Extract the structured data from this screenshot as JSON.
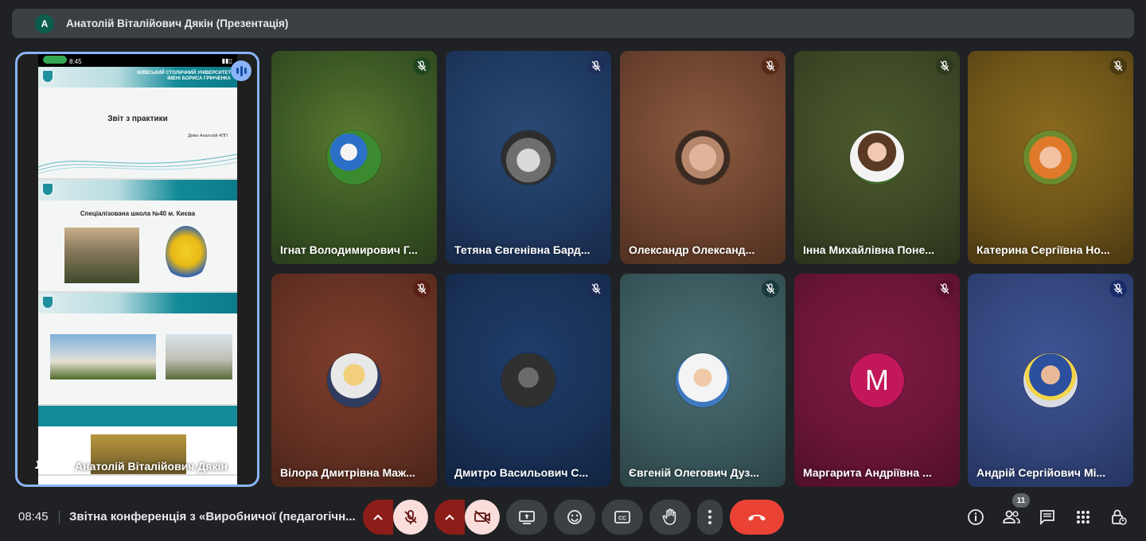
{
  "header": {
    "avatar_letter": "A",
    "title": "Анатолій Віталійович Дякін (Презентація)"
  },
  "presentation": {
    "owner_name": "Анатолій Віталійович Дякін",
    "phone_time": "8:45",
    "slides": [
      {
        "band_text": "КИЇВСЬКИЙ СТОЛИЧНИЙ УНІВЕРСИТЕТ ІМЕНІ БОРИСА ГРІНЧЕНКА",
        "title": "Звіт з практики",
        "author": "Дякін Анатолій 4ПП"
      },
      {
        "title": "Спеціалізована школа №40 м. Києва"
      },
      {
        "title": ""
      },
      {
        "title": ""
      }
    ]
  },
  "participants": [
    {
      "name": "Ігнат Володимирович Г...",
      "mic_color": "#1e4620",
      "bg": "radial-gradient(circle at 50% 40%, #5a7a30 0%, #3d5a25 50%, #2a3d1c 100%)",
      "avatar_type": "photo",
      "avatar_bg": "radial-gradient(circle at 40% 40%, #f4f4f4 0 18%, #2b6fc7 19% 40%, #3b8a2f 41% 100%)"
    },
    {
      "name": "Тетяна Євгенівна Бард...",
      "mic_color": "#1d2f5a",
      "bg": "radial-gradient(circle at 50% 40%, #2a4a74 0%, #1f3a60 55%, #17294a 100%)",
      "avatar_type": "photo",
      "avatar_bg": "radial-gradient(circle at 50% 55%, #d9d9d9 0 28%, #6e6e6e 30% 55%, #2e2e2e 56% 100%)"
    },
    {
      "name": "Олександр Олександ...",
      "mic_color": "#5a2a18",
      "bg": "radial-gradient(circle at 50% 40%, #8a5a3e 0%, #6e4430 55%, #50301f 100%)",
      "avatar_type": "photo",
      "avatar_bg": "radial-gradient(circle at 50% 50%, #e0b39a 0 35%, #b7876c 36% 55%, #3a2a22 56% 100%)"
    },
    {
      "name": "Інна Михайлівна Поне...",
      "mic_color": "#2d3a1e",
      "bg": "radial-gradient(circle at 50% 40%, #4c5a2c 0%, #3d4926 55%, #2a331b 100%)",
      "avatar_type": "photo",
      "avatar_bg": "radial-gradient(circle at 50% 40%, #f1c9b0 0 22%, #5a3a24 23% 45%, #f3f3f3 46% 70%, #3f6b2c 71% 100%)"
    },
    {
      "name": "Катерина Сергіївна Но...",
      "mic_color": "#4a3a10",
      "bg": "radial-gradient(circle at 50% 40%, #8a6a1e 0%, #6e5418 55%, #4a3812 100%)",
      "avatar_type": "photo",
      "avatar_bg": "radial-gradient(circle at 50% 50%, #f2c2a2 0 28%, #e07a2a 29% 55%, #6b8b2e 56% 100%)"
    },
    {
      "name": "Вілора Дмитрівна Маж...",
      "mic_color": "#5a1f14",
      "bg": "radial-gradient(circle at 50% 40%, #7e3e2c 0%, #663224 55%, #4a2419 100%)",
      "avatar_type": "photo",
      "avatar_bg": "radial-gradient(circle at 50% 40%, #f2cf7a 0 25%, #e8e8e8 26% 55%, #2f3c60 56% 100%)"
    },
    {
      "name": "Дмитро Васильович С...",
      "mic_color": "#1b2b52",
      "bg": "radial-gradient(circle at 50% 40%, #1f3c6a 0%, #193257 55%, #112341 100%)",
      "avatar_type": "photo",
      "avatar_bg": "radial-gradient(circle at 50% 45%, #6b6b6b 0 25%, #303030 26% 100%)"
    },
    {
      "name": "Євгеній Олегович Дуз...",
      "mic_color": "#1c3a3e",
      "bg": "radial-gradient(circle at 50% 40%, #4a6e72 0%, #3b5a5e 55%, #2a4245 100%)",
      "avatar_type": "photo",
      "avatar_bg": "radial-gradient(circle at 50% 45%, #f0c9a8 0 22%, #f4f4f4 23% 60%, #3f7ac0 61% 100%)"
    },
    {
      "name": "Маргарита Андріївна ...",
      "mic_color": "#5a0f2c",
      "bg": "radial-gradient(circle at 50% 40%, #7e1a42 0%, #6b1538 55%, #4f0f29 100%)",
      "avatar_type": "letter",
      "letter": "M"
    },
    {
      "name": "Андрій Сергійович Мі...",
      "mic_color": "#1a2c6a",
      "bg": "radial-gradient(circle at 50% 40%, #3e5494 0%, #33467c 55%, #243360 100%)",
      "avatar_type": "photo",
      "avatar_bg": "radial-gradient(circle at 50% 40%, #e8b998 0 22%, #2c4f9e 23% 50%, #f2d54a 51% 60%, #d9dce4 61% 100%)"
    }
  ],
  "bottom": {
    "time": "08:45",
    "meeting_title": "Звітна конференція з «Виробничої (педагогічн...",
    "participants_count": "11",
    "hangup_color": "#ea4335"
  }
}
